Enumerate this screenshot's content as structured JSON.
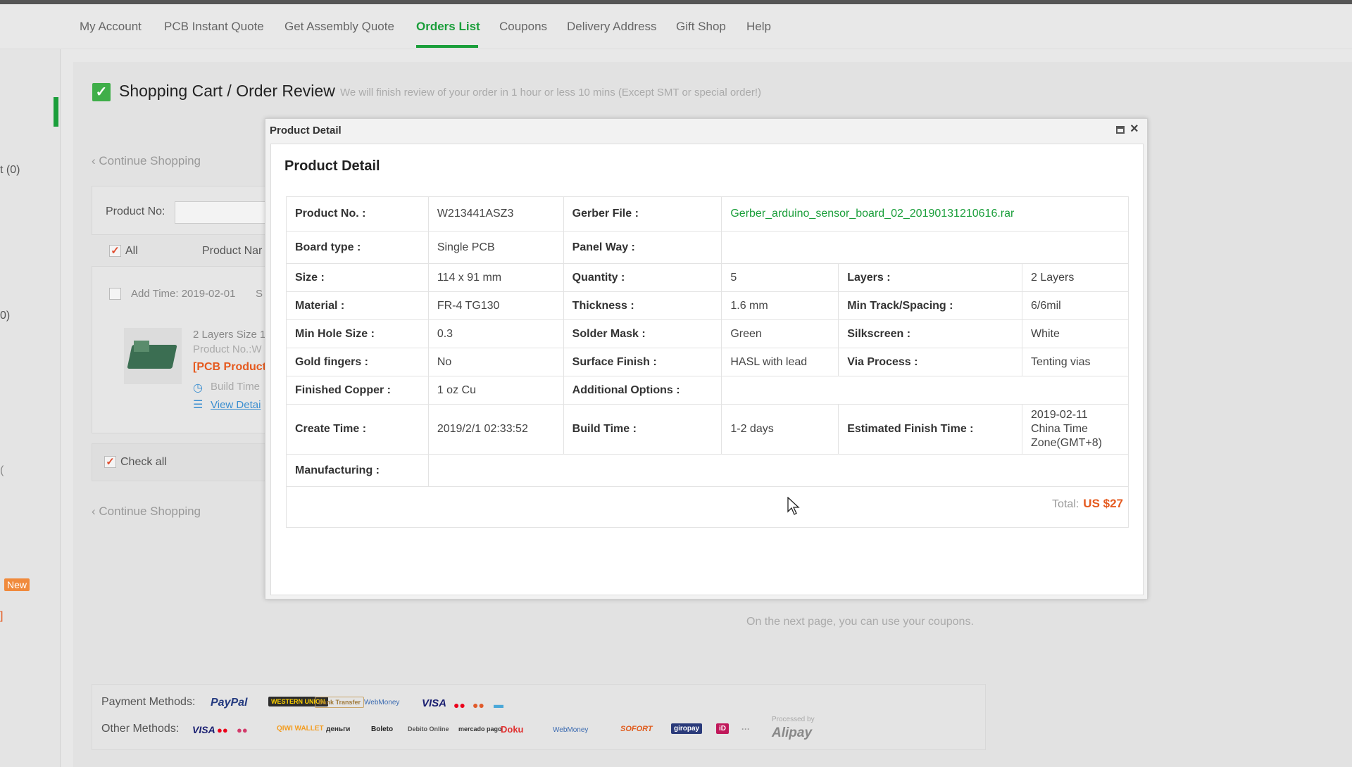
{
  "nav": {
    "items": [
      {
        "label": "My Account"
      },
      {
        "label": "PCB Instant Quote"
      },
      {
        "label": "Get Assembly Quote"
      },
      {
        "label": "Orders List"
      },
      {
        "label": "Coupons"
      },
      {
        "label": "Delivery Address"
      },
      {
        "label": "Gift Shop"
      },
      {
        "label": "Help"
      }
    ],
    "active": "Orders List"
  },
  "sidebar": {
    "item_a": "t (0)",
    "item_b": "0)",
    "item_c": "(",
    "item_d": "]",
    "new_badge": "New"
  },
  "header": {
    "title": "Shopping Cart / Order Review",
    "subtitle": "We will finish review of your order in 1 hour or less 10 mins (Except SMT or special order!)"
  },
  "cart": {
    "continue_shopping": "‹ Continue Shopping",
    "product_no_label": "Product No:",
    "all_label": "All",
    "product_name_col": "Product Nar",
    "add_time": "Add Time: 2019-02-01",
    "add_time_tail": "S",
    "item_line1": "2 Layers Size 1",
    "item_line2": "Product No.:W",
    "item_line3": "[PCB Producti",
    "item_build": "Build Time",
    "item_view": "View Detai",
    "check_all": "Check all",
    "continue_shopping_2": "‹ Continue Shopping",
    "coupon_note": "On the next page, you can use your coupons."
  },
  "modal": {
    "window_title": "Product Detail",
    "panel_title": "Product Detail",
    "labels": {
      "product_no": "Product No. :",
      "gerber": "Gerber File :",
      "board_type": "Board type :",
      "panel_way": "Panel Way :",
      "size": "Size :",
      "quantity": "Quantity :",
      "layers": "Layers :",
      "material": "Material :",
      "thickness": "Thickness :",
      "min_track": "Min Track/Spacing :",
      "min_hole": "Min Hole Size :",
      "solder_mask": "Solder Mask :",
      "silkscreen": "Silkscreen :",
      "gold_fingers": "Gold fingers :",
      "surface_finish": "Surface Finish :",
      "via_process": "Via Process :",
      "finished_copper": "Finished Copper :",
      "additional_options": "Additional Options :",
      "create_time": "Create Time :",
      "build_time": "Build Time :",
      "estimated_finish": "Estimated Finish Time :",
      "manufacturing": "Manufacturing :",
      "total": "Total:"
    },
    "values": {
      "product_no": "W213441ASZ3",
      "gerber": "Gerber_arduino_sensor_board_02_20190131210616.rar",
      "board_type": "Single PCB",
      "panel_way": "",
      "size": "114 x 91 mm",
      "quantity": "5",
      "layers": "2 Layers",
      "material": "FR-4 TG130",
      "thickness": "1.6 mm",
      "min_track": "6/6mil",
      "min_hole": "0.3",
      "solder_mask": "Green",
      "silkscreen": "White",
      "gold_fingers": "No",
      "surface_finish": "HASL with lead",
      "via_process": "Tenting vias",
      "finished_copper": "1 oz Cu",
      "additional_options": "",
      "create_time": "2019/2/1 02:33:52",
      "build_time": "1-2 days",
      "estimated_finish_1": "2019-02-11",
      "estimated_finish_2": "China Time",
      "estimated_finish_3": "Zone(GMT+8)",
      "manufacturing": "",
      "total": "US $27"
    }
  },
  "payment": {
    "label": "Payment Methods:",
    "other_label": "Other Methods:",
    "logos": {
      "paypal": "PayPal",
      "western_union": "WESTERN UNION",
      "bank_transfer": "Bank Transfer",
      "webmoney": "WebMoney",
      "visa": "VISA",
      "visa2": "VISA",
      "qiwi": "QIWI WALLET",
      "yandex": "деньги",
      "boleto": "Boleto",
      "debito": "Debito Online",
      "mercado": "mercado pago",
      "doku": "Doku",
      "webmoney2": "WebMoney",
      "sofort": "SOFORT",
      "giropay": "giropay",
      "ideal": "iD",
      "more": "···",
      "processed_by": "Processed by",
      "alipay": "Alipay"
    }
  },
  "colors": {
    "brand_green": "#1a9e3a",
    "price_orange": "#e55a1f"
  }
}
